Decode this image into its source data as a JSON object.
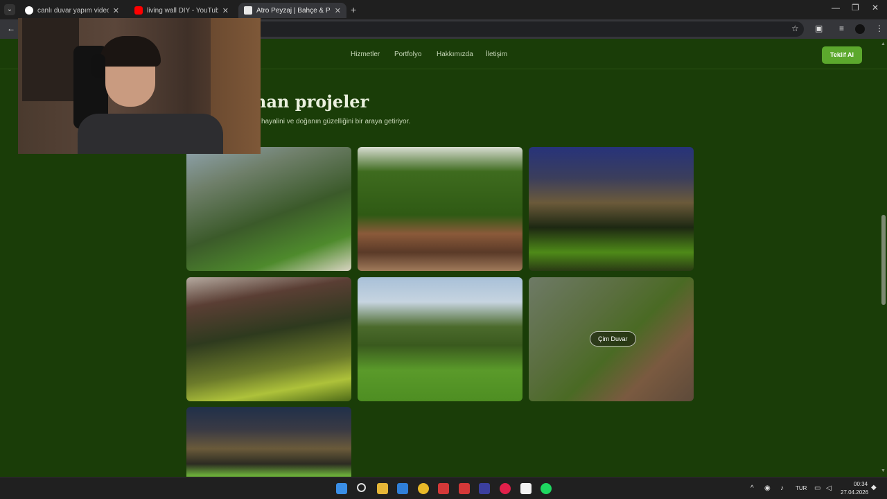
{
  "browser": {
    "tabs": [
      {
        "title": "canlı duvar yapım videosu - Go",
        "close": "✕"
      },
      {
        "title": "living wall DIY - YouTube",
        "close": "✕"
      },
      {
        "title": "Atro Peyzaj | Bahçe & Peyzaj Ta",
        "close": "✕"
      }
    ],
    "new_tab": "+",
    "controls": {
      "minimize": "—",
      "restore": "❐",
      "close": "✕"
    },
    "back": "←",
    "bookmark": "☆",
    "menu": "⋮"
  },
  "site": {
    "nav": [
      "Hizmetler",
      "Portfolyo",
      "Hakkımızda",
      "İletişim"
    ],
    "cta": "Teklif Al",
    "section_title": "han projeler",
    "section_subtitle": "hayalini ve doğanın güzelliğini bir araya getiriyor.",
    "hover_badge": "Çim Duvar"
  },
  "taskbar": {
    "lang": "TUR",
    "time": "00:34",
    "date": "27.04.2026",
    "tray_arrow": "^"
  },
  "colors": {
    "page_bg": "#1a3d08",
    "accent": "#5ca82d"
  }
}
